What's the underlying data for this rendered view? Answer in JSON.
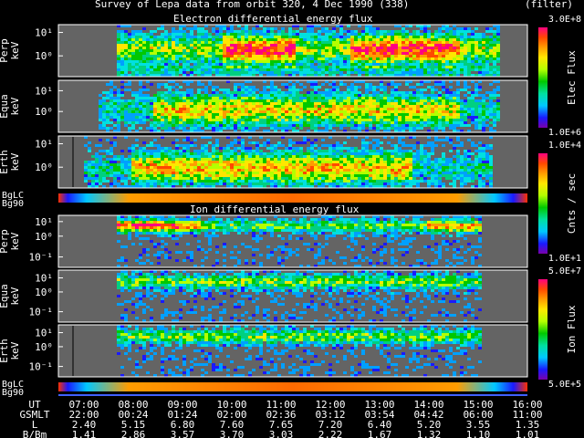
{
  "title": "Survey of Lepa data from orbit 320,  4 Dec 1990 (338)",
  "filter_label": "(filter)",
  "chart_data": {
    "type": "heatmap",
    "panels": [
      {
        "group": "electron",
        "label_top": "Perp",
        "label_bottom": "keV",
        "ticks": [
          "10¹",
          "10⁰"
        ]
      },
      {
        "group": "electron",
        "label_top": "Equa",
        "label_bottom": "keV",
        "ticks": [
          "10¹",
          "10⁰"
        ]
      },
      {
        "group": "electron",
        "label_top": "Erth",
        "label_bottom": "keV",
        "ticks": [
          "10¹",
          "10⁰"
        ]
      },
      {
        "group": "ion",
        "label_top": "Perp",
        "label_bottom": "keV",
        "ticks": [
          "10¹",
          "10⁰",
          "10⁻¹"
        ]
      },
      {
        "group": "ion",
        "label_top": "Equa",
        "label_bottom": "keV",
        "ticks": [
          "10¹",
          "10⁰",
          "10⁻¹"
        ]
      },
      {
        "group": "ion",
        "label_top": "Erth",
        "label_bottom": "keV",
        "ticks": [
          "10¹",
          "10⁰",
          "10⁻¹"
        ]
      }
    ],
    "section_titles": {
      "electron": "Electron differential energy flux",
      "ion": "Ion differential energy flux"
    },
    "strip_labels": {
      "top": "BgLC",
      "bottom": "Bg90"
    },
    "colorbars": [
      {
        "title": "Elec Flux",
        "max": "3.0E+8",
        "min": "1.0E+6"
      },
      {
        "title": "Cnts / sec",
        "max": "1.0E+4",
        "min": "1.0E+1"
      },
      {
        "title": "Ion Flux",
        "max": "5.0E+7",
        "min": "5.0E+5"
      }
    ],
    "axis_rows": [
      {
        "label": "UT",
        "values": [
          "07:00",
          "08:00",
          "09:00",
          "10:00",
          "11:00",
          "12:00",
          "13:00",
          "14:00",
          "15:00",
          "16:00"
        ]
      },
      {
        "label": "GSMLT",
        "values": [
          "22:00",
          "00:24",
          "01:24",
          "02:00",
          "02:36",
          "03:12",
          "03:54",
          "04:42",
          "06:00",
          "11:00"
        ]
      },
      {
        "label": "L",
        "values": [
          "2.40",
          "5.15",
          "6.80",
          "7.60",
          "7.65",
          "7.20",
          "6.40",
          "5.20",
          "3.55",
          "1.35"
        ]
      },
      {
        "label": "B/Bm",
        "values": [
          "1.41",
          "2.86",
          "3.57",
          "3.70",
          "3.03",
          "2.22",
          "1.67",
          "1.32",
          "1.10",
          "1.01"
        ]
      }
    ]
  }
}
